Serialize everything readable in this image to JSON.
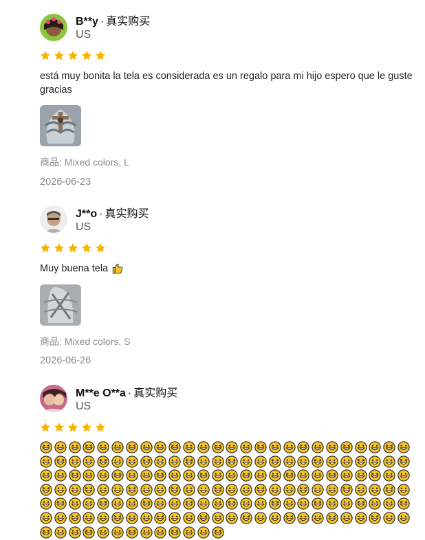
{
  "reviews": [
    {
      "user": "B**y",
      "badge": "真实购买",
      "country": "US",
      "rating": 5,
      "text": "está muy bonita la tela es considerada es un regalo para mi hijo espero que le guste gracias",
      "product_label": "商品:",
      "product_value": "Mixed colors, L",
      "date": "2026-06-23"
    },
    {
      "user": "J**o",
      "badge": "真实购买",
      "country": "US",
      "rating": 5,
      "text": "Muy buena tela",
      "text_icon": "thumbs-up-emoji",
      "product_label": "商品:",
      "product_value": "Mixed colors, S",
      "date": "2026-06-26"
    },
    {
      "user": "M**e O**a",
      "badge": "真实购买",
      "country": "US",
      "rating": 5,
      "text_emoji_count": 169,
      "text_icon": "smiley-emoji"
    }
  ],
  "colors": {
    "star": "#f6b400",
    "muted": "#8a8a8a",
    "emoji_face": "#f7c325"
  }
}
